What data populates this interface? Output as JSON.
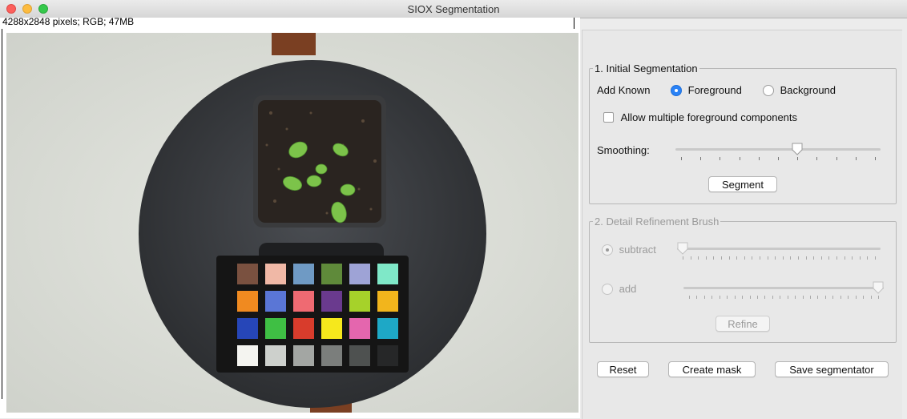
{
  "window": {
    "title": "SIOX Segmentation"
  },
  "image": {
    "info": "4288x2848 pixels; RGB; 47MB"
  },
  "initial_segmentation": {
    "legend": "1. Initial Segmentation",
    "add_known_label": "Add Known",
    "foreground_label": "Foreground",
    "background_label": "Background",
    "selected": "Foreground",
    "multiple_components_label": "Allow multiple foreground components",
    "multiple_components_checked": false,
    "smoothing_label": "Smoothing:",
    "smoothing_value": 0.6,
    "segment_button": "Segment"
  },
  "detail_refinement": {
    "legend": "2. Detail Refinement Brush",
    "subtract_label": "subtract",
    "add_label": "add",
    "selected": "subtract",
    "subtract_value": 0.0,
    "add_value": 1.0,
    "refine_button": "Refine"
  },
  "actions": {
    "reset_button": "Reset",
    "create_mask_button": "Create mask",
    "save_button": "Save segmentator"
  },
  "colors": {
    "accent": "#2a82f6",
    "close": "#fc605c",
    "minimize": "#fdbc40",
    "zoom": "#34c84a"
  }
}
